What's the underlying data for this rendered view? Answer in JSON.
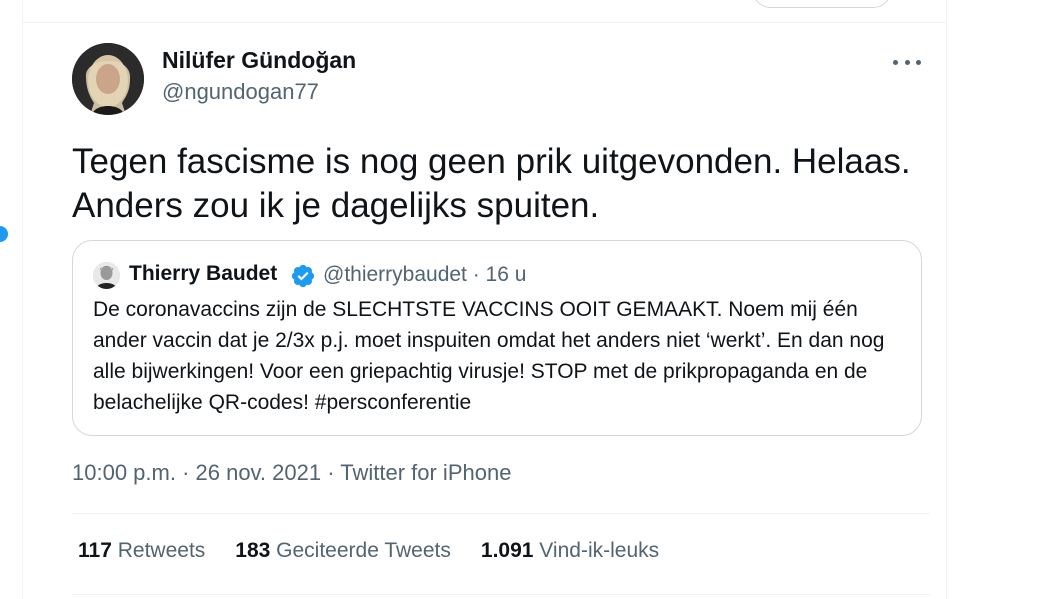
{
  "tweet": {
    "author": {
      "display_name": "Nilüfer Gündoğan",
      "handle": "@ngundogan77"
    },
    "text_line1": "Tegen fascisme is nog geen prik uitgevonden. Helaas.",
    "text_line2": "Anders zou ik je dagelijks spuiten.",
    "timestamp": "10:00 p.m. · 26 nov. 2021 · Twitter for iPhone",
    "stats": {
      "retweets_count": "117",
      "retweets_label": "Retweets",
      "quotes_count": "183",
      "quotes_label": "Geciteerde Tweets",
      "likes_count": "1.091",
      "likes_label": "Vind-ik-leuks"
    },
    "more_icon": "ellipsis-icon"
  },
  "quoted_tweet": {
    "display_name": "Thierry Baudet",
    "verified_icon": "verified-badge-icon",
    "meta": "@thierrybaudet · 16 u",
    "text": "De coronavaccins zijn de SLECHTSTE VACCINS OOIT GEMAAKT. Noem mij één ander vaccin dat je 2/3x p.j. moet inspuiten omdat het anders niet ‘werkt’. En dan nog alle bijwerkingen! Voor een griepachtig virusje! STOP met de prikpropaganda en de belachelijke QR-codes! #persconferentie"
  },
  "colors": {
    "primary_text": "#0f1419",
    "secondary_text": "#536471",
    "accent": "#1d9bf0",
    "border": "#cfd9de"
  }
}
